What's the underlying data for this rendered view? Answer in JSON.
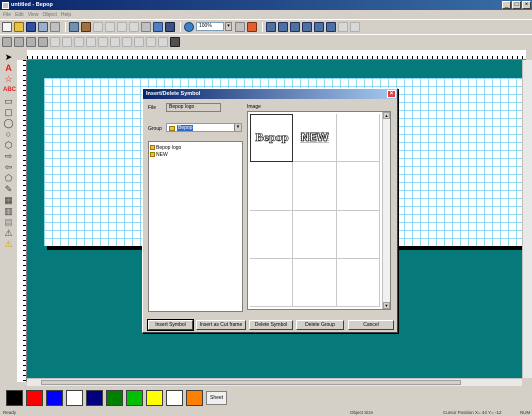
{
  "window": {
    "title": "untitled - Bepop"
  },
  "menu": [
    "File",
    "Edit",
    "View",
    "Object",
    "Help"
  ],
  "toolbar": {
    "zoom_value": "100%"
  },
  "dialog": {
    "title": "Insert/Delete Symbol",
    "file_label": "File",
    "file_value": "Bepop logo",
    "image_label": "Image",
    "group_label": "Group",
    "group_value": "Bepop",
    "tree_items": [
      "Bepop logo",
      "NEW"
    ],
    "images": [
      "Bepop",
      "NEW"
    ],
    "buttons": {
      "insert_symbol": "Insert Symbol",
      "insert_cut_frame": "Insert as Cut frame",
      "delete_symbol": "Delete Symbol",
      "delete_group": "Delete Group",
      "cancel": "Cancel"
    }
  },
  "palette": {
    "colors": [
      "#000000",
      "#ff0000",
      "#0000ff",
      "#ffffff",
      "#000080",
      "#008000",
      "#00c000",
      "#ffff00",
      "#ffffff",
      "#ff8000"
    ],
    "sheet_label": "Sheet"
  },
  "status": {
    "ready": "Ready",
    "object_size": "Object Size",
    "cursor_position": "Cursor Position  X= 44  Y= -12",
    "num": "NUM"
  }
}
